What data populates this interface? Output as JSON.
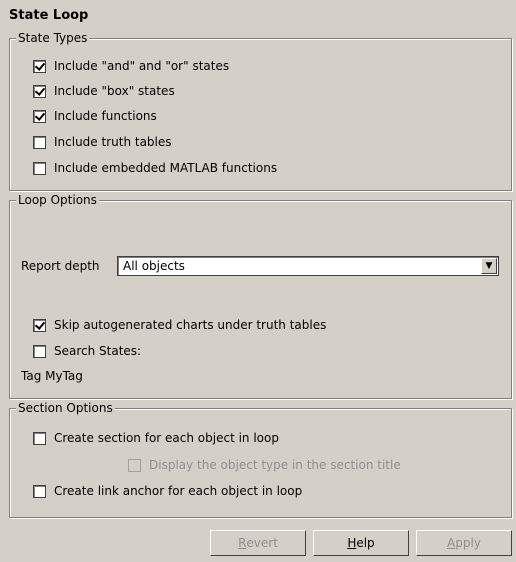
{
  "title": "State Loop",
  "state_types": {
    "legend": "State Types",
    "items": [
      {
        "label": "Include \"and\" and \"or\" states",
        "checked": true
      },
      {
        "label": "Include \"box\" states",
        "checked": true
      },
      {
        "label": "Include functions",
        "checked": true
      },
      {
        "label": "Include truth tables",
        "checked": false
      },
      {
        "label": "Include embedded MATLAB functions",
        "checked": false
      }
    ]
  },
  "loop_options": {
    "legend": "Loop Options",
    "report_depth_label": "Report depth",
    "report_depth_value": "All objects",
    "skip_autogen_label": "Skip autogenerated charts under truth tables",
    "skip_autogen_checked": true,
    "search_states_label": "Search States:",
    "search_states_checked": false,
    "tag_text": "Tag MyTag"
  },
  "section_options": {
    "legend": "Section Options",
    "create_section_label": "Create section for each object in loop",
    "create_section_checked": false,
    "display_type_label": "Display the object type in the section title",
    "display_type_checked": false,
    "display_type_enabled": false,
    "create_anchor_label": "Create link anchor for each object in loop",
    "create_anchor_checked": false
  },
  "buttons": {
    "revert": {
      "first": "R",
      "rest": "evert",
      "enabled": false
    },
    "help": {
      "first": "H",
      "rest": "elp",
      "enabled": true
    },
    "apply": {
      "first": "A",
      "rest": "pply",
      "enabled": false
    }
  }
}
